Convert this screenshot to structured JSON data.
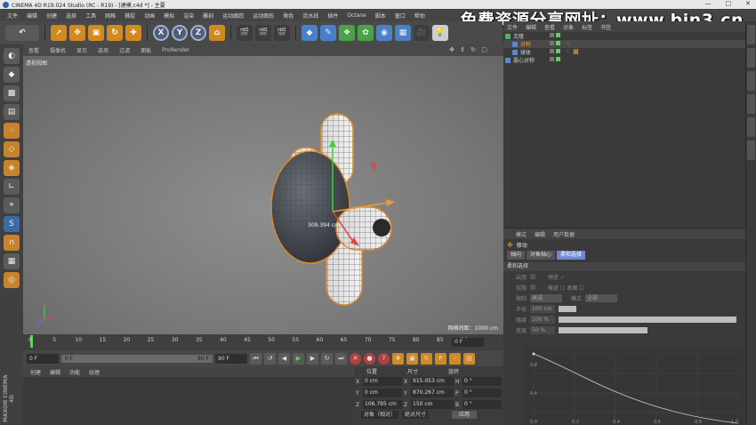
{
  "window": {
    "title": "CINEMA 4D R19.024 Studio (RC - R19) - [建模.c4d *] - 主要",
    "controls": [
      "—",
      "□",
      "✕"
    ]
  },
  "watermark": "免费资源分享网址：www.bin3.cn",
  "menu": [
    "文件",
    "编辑",
    "创建",
    "选择",
    "工具",
    "网格",
    "捕捉",
    "动画",
    "模拟",
    "渲染",
    "雕刻",
    "运动跟踪",
    "运动图形",
    "角色",
    "流水线",
    "插件",
    "Octane",
    "脚本",
    "窗口",
    "帮助"
  ],
  "toolbar": {
    "undo": "↶",
    "x": "X",
    "y": "Y",
    "z": "Z"
  },
  "viewport": {
    "menu": [
      "查看",
      "摄像机",
      "显示",
      "选项",
      "过滤",
      "面板",
      "ProRender"
    ],
    "label": "透视视图",
    "grid_info": "网格间距：1000 cm",
    "dimension_label": "309.394 cm"
  },
  "timeline": {
    "ticks": [
      "0",
      "5",
      "10",
      "15",
      "20",
      "25",
      "30",
      "35",
      "40",
      "45",
      "50",
      "55",
      "60",
      "65",
      "70",
      "75",
      "80",
      "85",
      "90"
    ],
    "current_frame": "0 F"
  },
  "playbar": {
    "start": "0 F",
    "slider_left": "0 F",
    "slider_right": "90 F",
    "end": "90 F"
  },
  "material_panel": {
    "menu": [
      "创建",
      "编辑",
      "功能",
      "纹理"
    ]
  },
  "coordinates": {
    "headers": [
      "位置",
      "尺寸",
      "旋转"
    ],
    "rows": [
      {
        "axis": "X",
        "pos": "0 cm",
        "size_axis": "X",
        "size": "915.053 cm",
        "rot_axis": "H",
        "rot": "0 °"
      },
      {
        "axis": "Y",
        "pos": "0 cm",
        "size_axis": "Y",
        "size": "870.267 cm",
        "rot_axis": "P",
        "rot": "0 °"
      },
      {
        "axis": "Z",
        "pos": "106.795 cm",
        "size_axis": "Z",
        "size": "150 cm",
        "rot_axis": "B",
        "rot": "0 °"
      }
    ],
    "mode_select": "对象（相对）",
    "size_select": "绝对尺寸",
    "apply": "应用"
  },
  "objects": {
    "menu": [
      "文件",
      "编辑",
      "查看",
      "对象",
      "标签",
      "书签"
    ],
    "items": [
      {
        "name": "克隆",
        "selected": false
      },
      {
        "name": "对称",
        "selected": true
      },
      {
        "name": "球体",
        "selected": false
      },
      {
        "name": "震心对称",
        "selected": false
      }
    ]
  },
  "attributes": {
    "menu": [
      "模式",
      "编辑",
      "用户数据"
    ],
    "title": "移动",
    "tabs": [
      "轴向",
      "对象轴心",
      "柔和选择"
    ],
    "active_tab": "柔和选择",
    "section": "柔和选择",
    "rows": [
      {
        "label": "启用",
        "extra": "预览 ✓"
      },
      {
        "label": "仅限",
        "extra": "橡皮 ☐   表面 ☐"
      },
      {
        "label": "限制",
        "value": "衰减",
        "extra2": "模式",
        "value2": "全部"
      },
      {
        "label": "半径",
        "value": "100 cm"
      },
      {
        "label": "强度",
        "value": "100 %"
      },
      {
        "label": "宽度",
        "value": "50 %"
      }
    ],
    "bar_levels": [
      0.0,
      0.08,
      1.0,
      0.5
    ],
    "curve_labels": [
      "0.8",
      "0.4",
      "0.0",
      "0.2",
      "0.4",
      "0.6",
      "0.8",
      "1.0"
    ]
  },
  "colors": {
    "accent": "#d18a22",
    "active_tab": "#6d8ad0",
    "timeline_cursor": "#5fd05f"
  }
}
